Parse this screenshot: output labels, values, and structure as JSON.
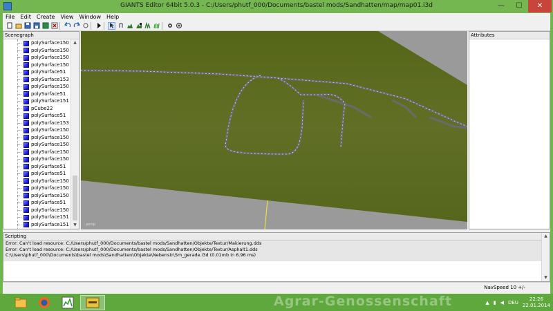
{
  "window": {
    "title": "GIANTS Editor 64bit 5.0.3 - C:/Users/phutf_000/Documents/bastel mods/Sandhatten/map/map01.i3d",
    "minimize": "—",
    "maximize": "☐",
    "close": "✕"
  },
  "menu": {
    "items": [
      "File",
      "Edit",
      "Create",
      "View",
      "Window",
      "Help"
    ]
  },
  "toolbar": {
    "icons": [
      "new-icon",
      "open-icon",
      "save-icon",
      "import-icon",
      "export-icon",
      "delete-icon",
      "undo-icon",
      "redo-icon",
      "play-icon",
      "select-icon",
      "move-icon",
      "terrain-sculpt-icon",
      "terrain-paint-icon",
      "foliage-paint-icon",
      "grass-icon",
      "settings-icon",
      "render-icon"
    ]
  },
  "scenegraph": {
    "title": "Scenegraph",
    "items": [
      "polySurface150",
      "polySurface150",
      "polySurface150",
      "polySurface150",
      "polySurface51",
      "polySurface153",
      "polySurface150",
      "polySurface51",
      "polySurface151",
      "pCube22",
      "polySurface51",
      "polySurface153",
      "polySurface150",
      "polySurface150",
      "polySurface150",
      "polySurface150",
      "polySurface150",
      "polySurface51",
      "polySurface51",
      "polySurface150",
      "polySurface150",
      "polySurface150",
      "polySurface51",
      "polySurface150",
      "polySurface151",
      "polySurface151"
    ]
  },
  "viewport": {
    "camera_label": "persp",
    "colors": {
      "terrain": "#5d6e23",
      "background": "#9a9a9a",
      "road": "#6a6a6a",
      "axis": "#f0e040"
    }
  },
  "attributes": {
    "title": "Attributes"
  },
  "scripting": {
    "title": "Scripting",
    "lines": [
      "Error: Can't load resource: C:/Users/phutf_000/Documents/bastel mods/Sandhatten/Objekte/Textur/Makierung.dds",
      "Error: Can't load resource: C:/Users/phutf_000/Documents/bastel mods/Sandhatten/Objekte/Textur/Asphalt1.dds",
      "C:\\Users\\phutf_000\\Documents\\bastel mods\\Sandhatten\\Objekte\\Nebenstr\\Sm_gerade.i3d (0.01mb in 6.96 ms)"
    ]
  },
  "statusbar": {
    "navspeed": "NavSpeed 10 +/-"
  },
  "taskbar": {
    "apps": [
      "file-explorer-icon",
      "firefox-icon",
      "task-manager-icon",
      "giants-editor-icon"
    ],
    "watermark": "Agrar-Genossenschaft",
    "language": "DEU",
    "time": "22:26",
    "date": "22.01.2014"
  }
}
